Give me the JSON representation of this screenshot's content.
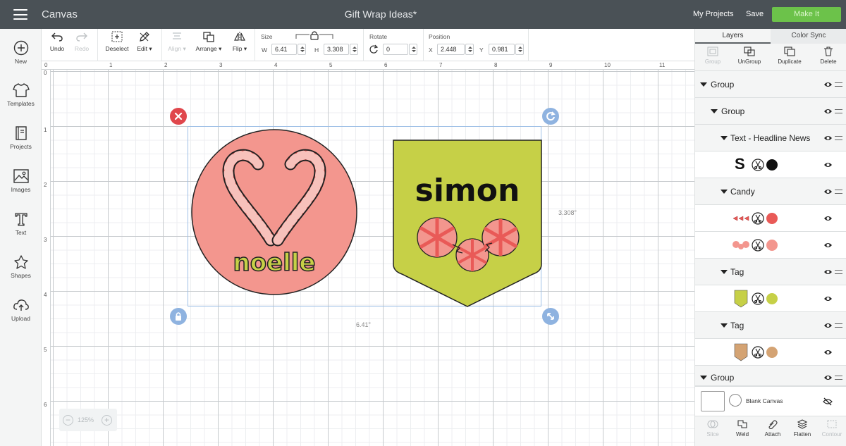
{
  "topbar": {
    "app_name": "Canvas",
    "doc_title": "Gift Wrap Ideas*",
    "my_projects": "My Projects",
    "save": "Save",
    "make_it": "Make It"
  },
  "sidebar": {
    "items": [
      {
        "label": "New",
        "icon": "plus-circle-icon"
      },
      {
        "label": "Templates",
        "icon": "tshirt-icon"
      },
      {
        "label": "Projects",
        "icon": "projects-book-icon"
      },
      {
        "label": "Images",
        "icon": "image-icon"
      },
      {
        "label": "Text",
        "icon": "text-t-icon"
      },
      {
        "label": "Shapes",
        "icon": "shapes-icon"
      },
      {
        "label": "Upload",
        "icon": "upload-cloud-icon"
      }
    ]
  },
  "toolbar": {
    "undo": "Undo",
    "redo": "Redo",
    "deselect": "Deselect",
    "edit": "Edit",
    "align": "Align",
    "arrange": "Arrange",
    "flip": "Flip",
    "size_label": "Size",
    "w_label": "W",
    "w_value": "6.41",
    "h_label": "H",
    "h_value": "3.308",
    "rotate_label": "Rotate",
    "rotate_value": "0",
    "position_label": "Position",
    "x_label": "X",
    "x_value": "2.448",
    "y_label": "Y",
    "y_value": "0.981"
  },
  "rulers": {
    "top": [
      "0",
      "1",
      "2",
      "3",
      "4",
      "5",
      "6",
      "7",
      "8",
      "9",
      "10",
      "11"
    ],
    "left": [
      "0",
      "1",
      "2",
      "3",
      "4",
      "5",
      "6"
    ]
  },
  "canvas": {
    "width_label": "6.41\"",
    "height_label": "3.308\"",
    "zoom": "125%",
    "items": {
      "left_name": "noelle",
      "right_name": "simon"
    },
    "colors": {
      "circle": "#f3968e",
      "tag": "#c6d047",
      "name_green": "#c6d047",
      "candy_red": "#e95a57",
      "delete_handle": "#e0474c",
      "handle_blue": "#8fb3e0",
      "selection": "#9ec0e6"
    }
  },
  "panel": {
    "tabs": [
      "Layers",
      "Color Sync"
    ],
    "tools": {
      "group": "Group",
      "ungroup": "UnGroup",
      "duplicate": "Duplicate",
      "delete": "Delete"
    },
    "layers": [
      {
        "name": "Group",
        "type": "group"
      },
      {
        "name": "Group",
        "type": "group"
      },
      {
        "name": "Text - Headline News",
        "type": "group"
      },
      {
        "name": "S",
        "type": "item",
        "color": "#111111"
      },
      {
        "name": "Candy",
        "type": "group"
      },
      {
        "name": "",
        "type": "item",
        "color": "#e95a57"
      },
      {
        "name": "",
        "type": "item",
        "color": "#f3968e"
      },
      {
        "name": "Tag",
        "type": "group"
      },
      {
        "name": "",
        "type": "item",
        "color": "#c6d047"
      },
      {
        "name": "Tag",
        "type": "group"
      },
      {
        "name": "",
        "type": "item",
        "color": "#d4a373"
      },
      {
        "name": "Group",
        "type": "group"
      }
    ],
    "blank_canvas": "Blank Canvas",
    "bottom_tools": {
      "slice": "Slice",
      "weld": "Weld",
      "attach": "Attach",
      "flatten": "Flatten",
      "contour": "Contour"
    }
  }
}
